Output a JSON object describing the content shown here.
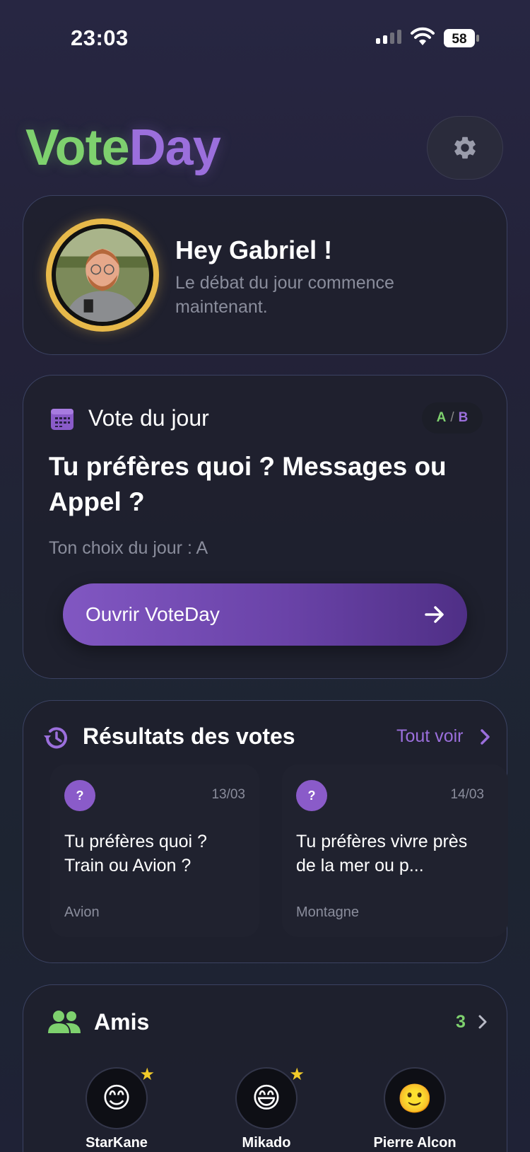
{
  "status": {
    "time": "23:03",
    "battery": "58"
  },
  "logo": {
    "part1": "Vote",
    "part2": "Day"
  },
  "greeting": {
    "title": "Hey Gabriel !",
    "subtitle": "Le débat du jour commence maintenant."
  },
  "daily_vote": {
    "label": "Vote du jour",
    "badge_a": "A",
    "badge_sep": "/",
    "badge_b": "B",
    "question": "Tu préfères quoi ? Messages ou Appel ?",
    "choice": "Ton choix du jour : A",
    "open_button": "Ouvrir VoteDay"
  },
  "results": {
    "title": "Résultats des votes",
    "see_all": "Tout voir",
    "items": [
      {
        "badge": "?",
        "date": "13/03",
        "question": "Tu préfères quoi ? Train ou Avion ?",
        "answer": "Avion"
      },
      {
        "badge": "?",
        "date": "14/03",
        "question": "Tu préfères vivre près de la mer ou p...",
        "answer": "Montagne"
      }
    ]
  },
  "friends": {
    "title": "Amis",
    "count": "3",
    "items": [
      {
        "name": "StarKane",
        "emoji": "😊",
        "star": "★"
      },
      {
        "name": "Mikado",
        "emoji": "😄",
        "star": "★"
      },
      {
        "name": "Pierre Alcon",
        "emoji": "🙂",
        "star": ""
      }
    ]
  },
  "colors": {
    "green": "#7ed16e",
    "purple": "#9b6fdc",
    "gold": "#e7b94a"
  }
}
